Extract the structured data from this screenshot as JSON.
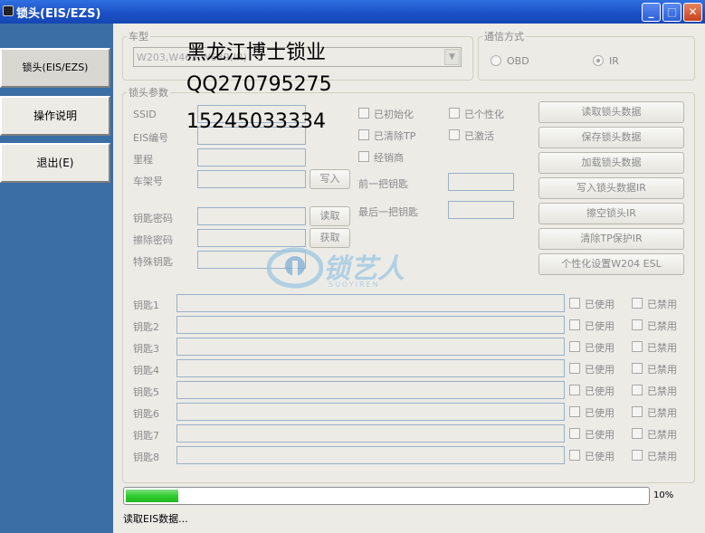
{
  "window": {
    "title": "锁头(EIS/EZS)",
    "buttons": {
      "minimize": "_",
      "maximize": "□",
      "close": "✕"
    }
  },
  "nav": {
    "items": [
      {
        "label": "锁头(EIS/EZS)"
      },
      {
        "label": "操作说明"
      },
      {
        "label": "退出(E)"
      }
    ]
  },
  "vehicle": {
    "legend": "车型",
    "selected": "W203,W463,W639(IR)"
  },
  "comm": {
    "legend": "通信方式",
    "options": [
      {
        "label": "OBD",
        "selected": false
      },
      {
        "label": "IR",
        "selected": true
      }
    ]
  },
  "params": {
    "legend": "锁头参数",
    "fields": {
      "ssid": "SSID",
      "eis_no": "EIS编号",
      "mileage": "里程",
      "vin": "车架号",
      "key_password": "钥匙密码",
      "erase_password": "擦除密码",
      "special_key": "特殊钥匙"
    },
    "buttons": {
      "write": "写入",
      "read": "读取",
      "fetch": "获取"
    },
    "checks": {
      "initialized": "已初始化",
      "personalized": "已个性化",
      "tp_cleared": "已清除TP",
      "activated": "已激活",
      "dealer": "经销商"
    },
    "prev_key_label": "前一把钥匙",
    "last_key_label": "最后一把钥匙"
  },
  "actions": [
    {
      "label": "读取锁头数据"
    },
    {
      "label": "保存锁头数据"
    },
    {
      "label": "加载锁头数据"
    },
    {
      "label": "写入锁头数据IR"
    },
    {
      "label": "擦空锁头IR"
    },
    {
      "label": "清除TP保护IR"
    },
    {
      "label": "个性化设置W204 ESL"
    }
  ],
  "keys": {
    "used_label": "已使用",
    "disabled_label": "已禁用",
    "rows": [
      {
        "label": "钥匙1"
      },
      {
        "label": "钥匙2"
      },
      {
        "label": "钥匙3"
      },
      {
        "label": "钥匙4"
      },
      {
        "label": "钥匙5"
      },
      {
        "label": "钥匙6"
      },
      {
        "label": "钥匙7"
      },
      {
        "label": "钥匙8"
      }
    ]
  },
  "overlay_text": {
    "line1": "黑龙江博士锁业",
    "line2": "QQ270795275",
    "line3": "15245033334"
  },
  "watermark": {
    "text": "锁艺人",
    "sub": "SUOYIREN"
  },
  "progress": {
    "value": 10,
    "label": "10%"
  },
  "status": "读取EIS数据..."
}
